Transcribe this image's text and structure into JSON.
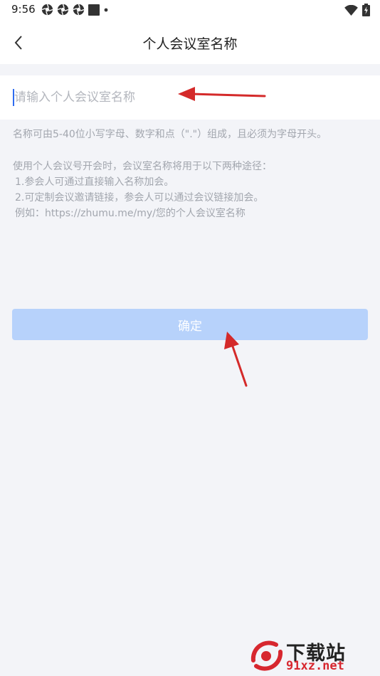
{
  "status_bar": {
    "time": "9:56",
    "left_icons": [
      "aperture-icon",
      "aperture-icon",
      "aperture-icon",
      "square-icon",
      "dot-icon"
    ],
    "right_icons": [
      "wifi-icon",
      "battery-charging-icon"
    ]
  },
  "header": {
    "back_icon": "chevron-left-icon",
    "title": "个人会议室名称"
  },
  "input": {
    "value": "",
    "placeholder": "请输入个人会议室名称"
  },
  "rule_text": "名称可由5-40位小写字母、数字和点（\".\"）组成，且必须为字母开头。",
  "usage": {
    "intro": "使用个人会议号开会时，会议室名称将用于以下两种途径：",
    "item1": "1.参会人可通过直接输入名称加会。",
    "item2": "2.可定制会议邀请链接，参会人可以通过会议链接加会。",
    "example": "例如：https://zhumu.me/my/您的个人会议室名称"
  },
  "confirm_label": "确定",
  "watermark": {
    "name": "下载站",
    "domain": "91xz.net"
  },
  "colors": {
    "page_background": "#f3f4f8",
    "button_disabled": "#b7d2fb",
    "hint_text": "#a2a6ae",
    "annotation_arrow": "#d42a2a",
    "caret": "#2f6cf0"
  }
}
